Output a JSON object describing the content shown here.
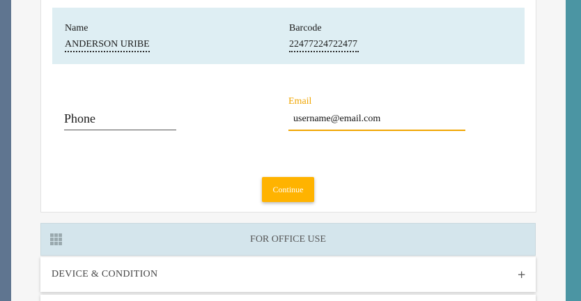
{
  "customer": {
    "name_label": "Name",
    "name_value": "ANDERSON URIBE",
    "barcode_label": "Barcode",
    "barcode_value": "22477224722477"
  },
  "form": {
    "phone_label": "Phone",
    "email_label": "Email",
    "email_value": "username@email.com",
    "continue_label": "Continue"
  },
  "office": {
    "title": "FOR OFFICE USE",
    "icon": "grid-icon"
  },
  "accordion": {
    "device_condition_title": "DEVICE & CONDITION",
    "expand_symbol": "+"
  },
  "colors": {
    "accent": "#ffb300",
    "info_band": "#deeef3",
    "office_bar": "#d4e5ec",
    "left_frame": "#5f7590",
    "right_frame": "#4b95a3"
  }
}
